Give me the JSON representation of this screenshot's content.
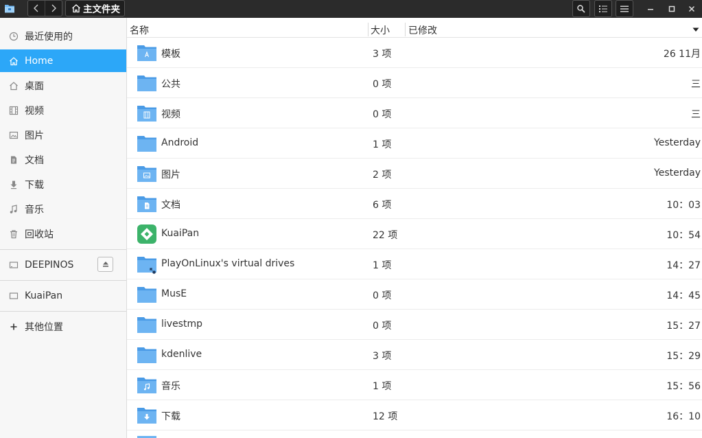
{
  "titlebar": {
    "breadcrumb_label": "主文件夹"
  },
  "sidebar": {
    "items": [
      {
        "label": "最近使用的",
        "icon": "clock-icon"
      },
      {
        "label": "Home",
        "icon": "home-icon"
      },
      {
        "label": "桌面",
        "icon": "desktop-icon"
      },
      {
        "label": "视频",
        "icon": "video-icon"
      },
      {
        "label": "图片",
        "icon": "picture-icon"
      },
      {
        "label": "文档",
        "icon": "document-icon"
      },
      {
        "label": "下载",
        "icon": "download-icon"
      },
      {
        "label": "音乐",
        "icon": "music-icon"
      },
      {
        "label": "回收站",
        "icon": "trash-icon"
      }
    ],
    "active_index": 1,
    "devices": [
      {
        "label": "DEEPINOS",
        "icon": "drive-icon"
      }
    ],
    "network": [
      {
        "label": "KuaiPan",
        "icon": "drive-icon"
      }
    ],
    "other_locations": {
      "label": "其他位置",
      "icon": "plus-icon"
    }
  },
  "columns": {
    "name": "名称",
    "size": "大小",
    "modified": "已修改"
  },
  "files": [
    {
      "name": "模板",
      "size": "3 项",
      "modified": "26 11月",
      "icon": "templates-folder-icon"
    },
    {
      "name": "公共",
      "size": "0 项",
      "modified": "三",
      "icon": "folder-icon"
    },
    {
      "name": "视频",
      "size": "0 项",
      "modified": "三",
      "icon": "videos-folder-icon"
    },
    {
      "name": "Android",
      "size": "1 项",
      "modified": "Yesterday",
      "icon": "folder-icon"
    },
    {
      "name": "图片",
      "size": "2 项",
      "modified": "Yesterday",
      "icon": "pictures-folder-icon"
    },
    {
      "name": "文档",
      "size": "6 项",
      "modified": "10：03",
      "icon": "documents-folder-icon"
    },
    {
      "name": "KuaiPan",
      "size": "22 项",
      "modified": "10：54",
      "icon": "kuaipan-app-icon"
    },
    {
      "name": "PlayOnLinux's virtual drives",
      "size": "1 项",
      "modified": "14：27",
      "icon": "link-folder-icon"
    },
    {
      "name": "MusE",
      "size": "0 项",
      "modified": "14：45",
      "icon": "folder-icon"
    },
    {
      "name": "livestmp",
      "size": "0 项",
      "modified": "15：27",
      "icon": "folder-icon"
    },
    {
      "name": "kdenlive",
      "size": "3 项",
      "modified": "15：29",
      "icon": "folder-icon"
    },
    {
      "name": "音乐",
      "size": "1 项",
      "modified": "15：56",
      "icon": "music-folder-icon"
    },
    {
      "name": "下载",
      "size": "12 项",
      "modified": "16：10",
      "icon": "downloads-folder-icon"
    }
  ],
  "colors": {
    "accent": "#2ca7f8",
    "folder": "#5aaaf0",
    "headerbar": "#2b2b2b",
    "kuaipan": "#3cb36a"
  }
}
